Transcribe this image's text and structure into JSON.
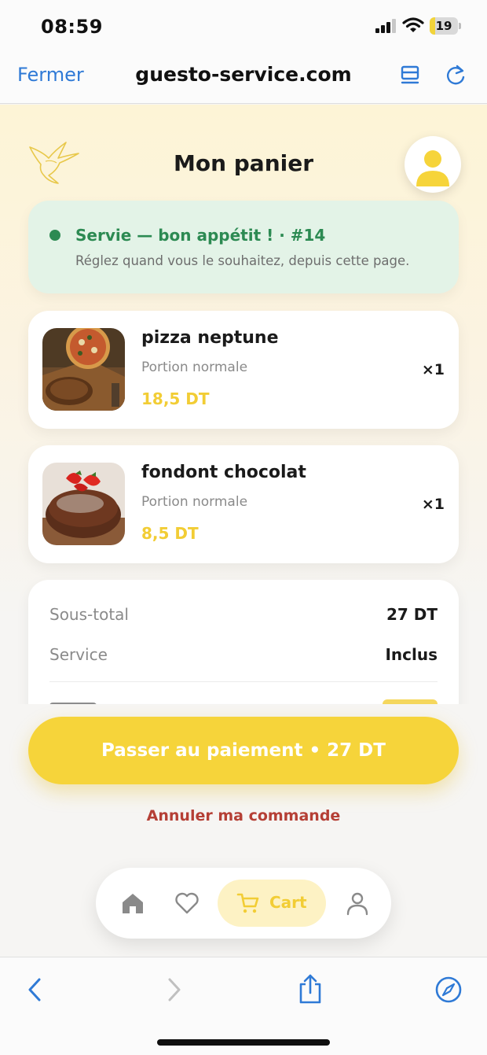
{
  "status_bar": {
    "time": "08:59",
    "battery": "19",
    "battery_level": 0.19
  },
  "browser": {
    "close_label": "Fermer",
    "url": "guesto-service.com"
  },
  "header": {
    "title": "Mon panier"
  },
  "order_status": {
    "title": "Servie — bon appétit ! · #14",
    "subtitle": "Réglez quand vous le souhaitez, depuis cette page."
  },
  "items": [
    {
      "name": "pizza neptune",
      "portion": "Portion normale",
      "price": "18,5 DT",
      "qty": "×1"
    },
    {
      "name": "fondont chocolat",
      "portion": "Portion normale",
      "price": "8,5 DT",
      "qty": "×1"
    }
  ],
  "summary": {
    "subtotal_label": "Sous-total",
    "subtotal_value": "27 DT",
    "service_label": "Service",
    "service_value": "Inclus"
  },
  "actions": {
    "pay_label": "Passer au paiement • 27 DT",
    "cancel_label": "Annuler ma commande"
  },
  "tabbar": {
    "items": [
      "home-icon",
      "heart-icon",
      "cart-icon",
      "user-icon"
    ],
    "active_label": "Cart"
  },
  "colors": {
    "accent": "#f6d43a",
    "success": "#2c8a52",
    "danger": "#b53f35",
    "link": "#2f7ad6"
  }
}
